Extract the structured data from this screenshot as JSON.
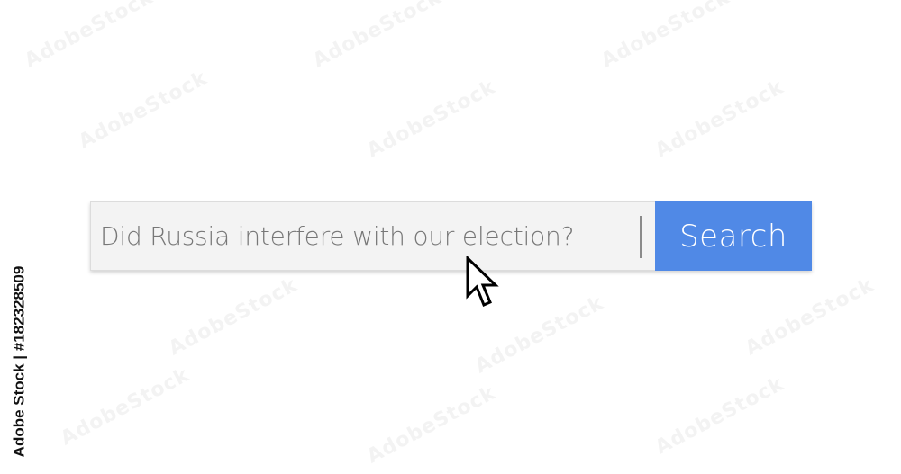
{
  "search": {
    "query": "Did Russia interfere with our election?",
    "button_label": "Search"
  },
  "watermark": {
    "text": "Adobe Stock",
    "credit": "Adobe Stock | #182328509"
  },
  "colors": {
    "button_bg": "#5089e6",
    "input_bg": "#f3f3f3",
    "query_text": "#777777"
  },
  "icons": {
    "cursor": "arrow-pointer-icon"
  }
}
